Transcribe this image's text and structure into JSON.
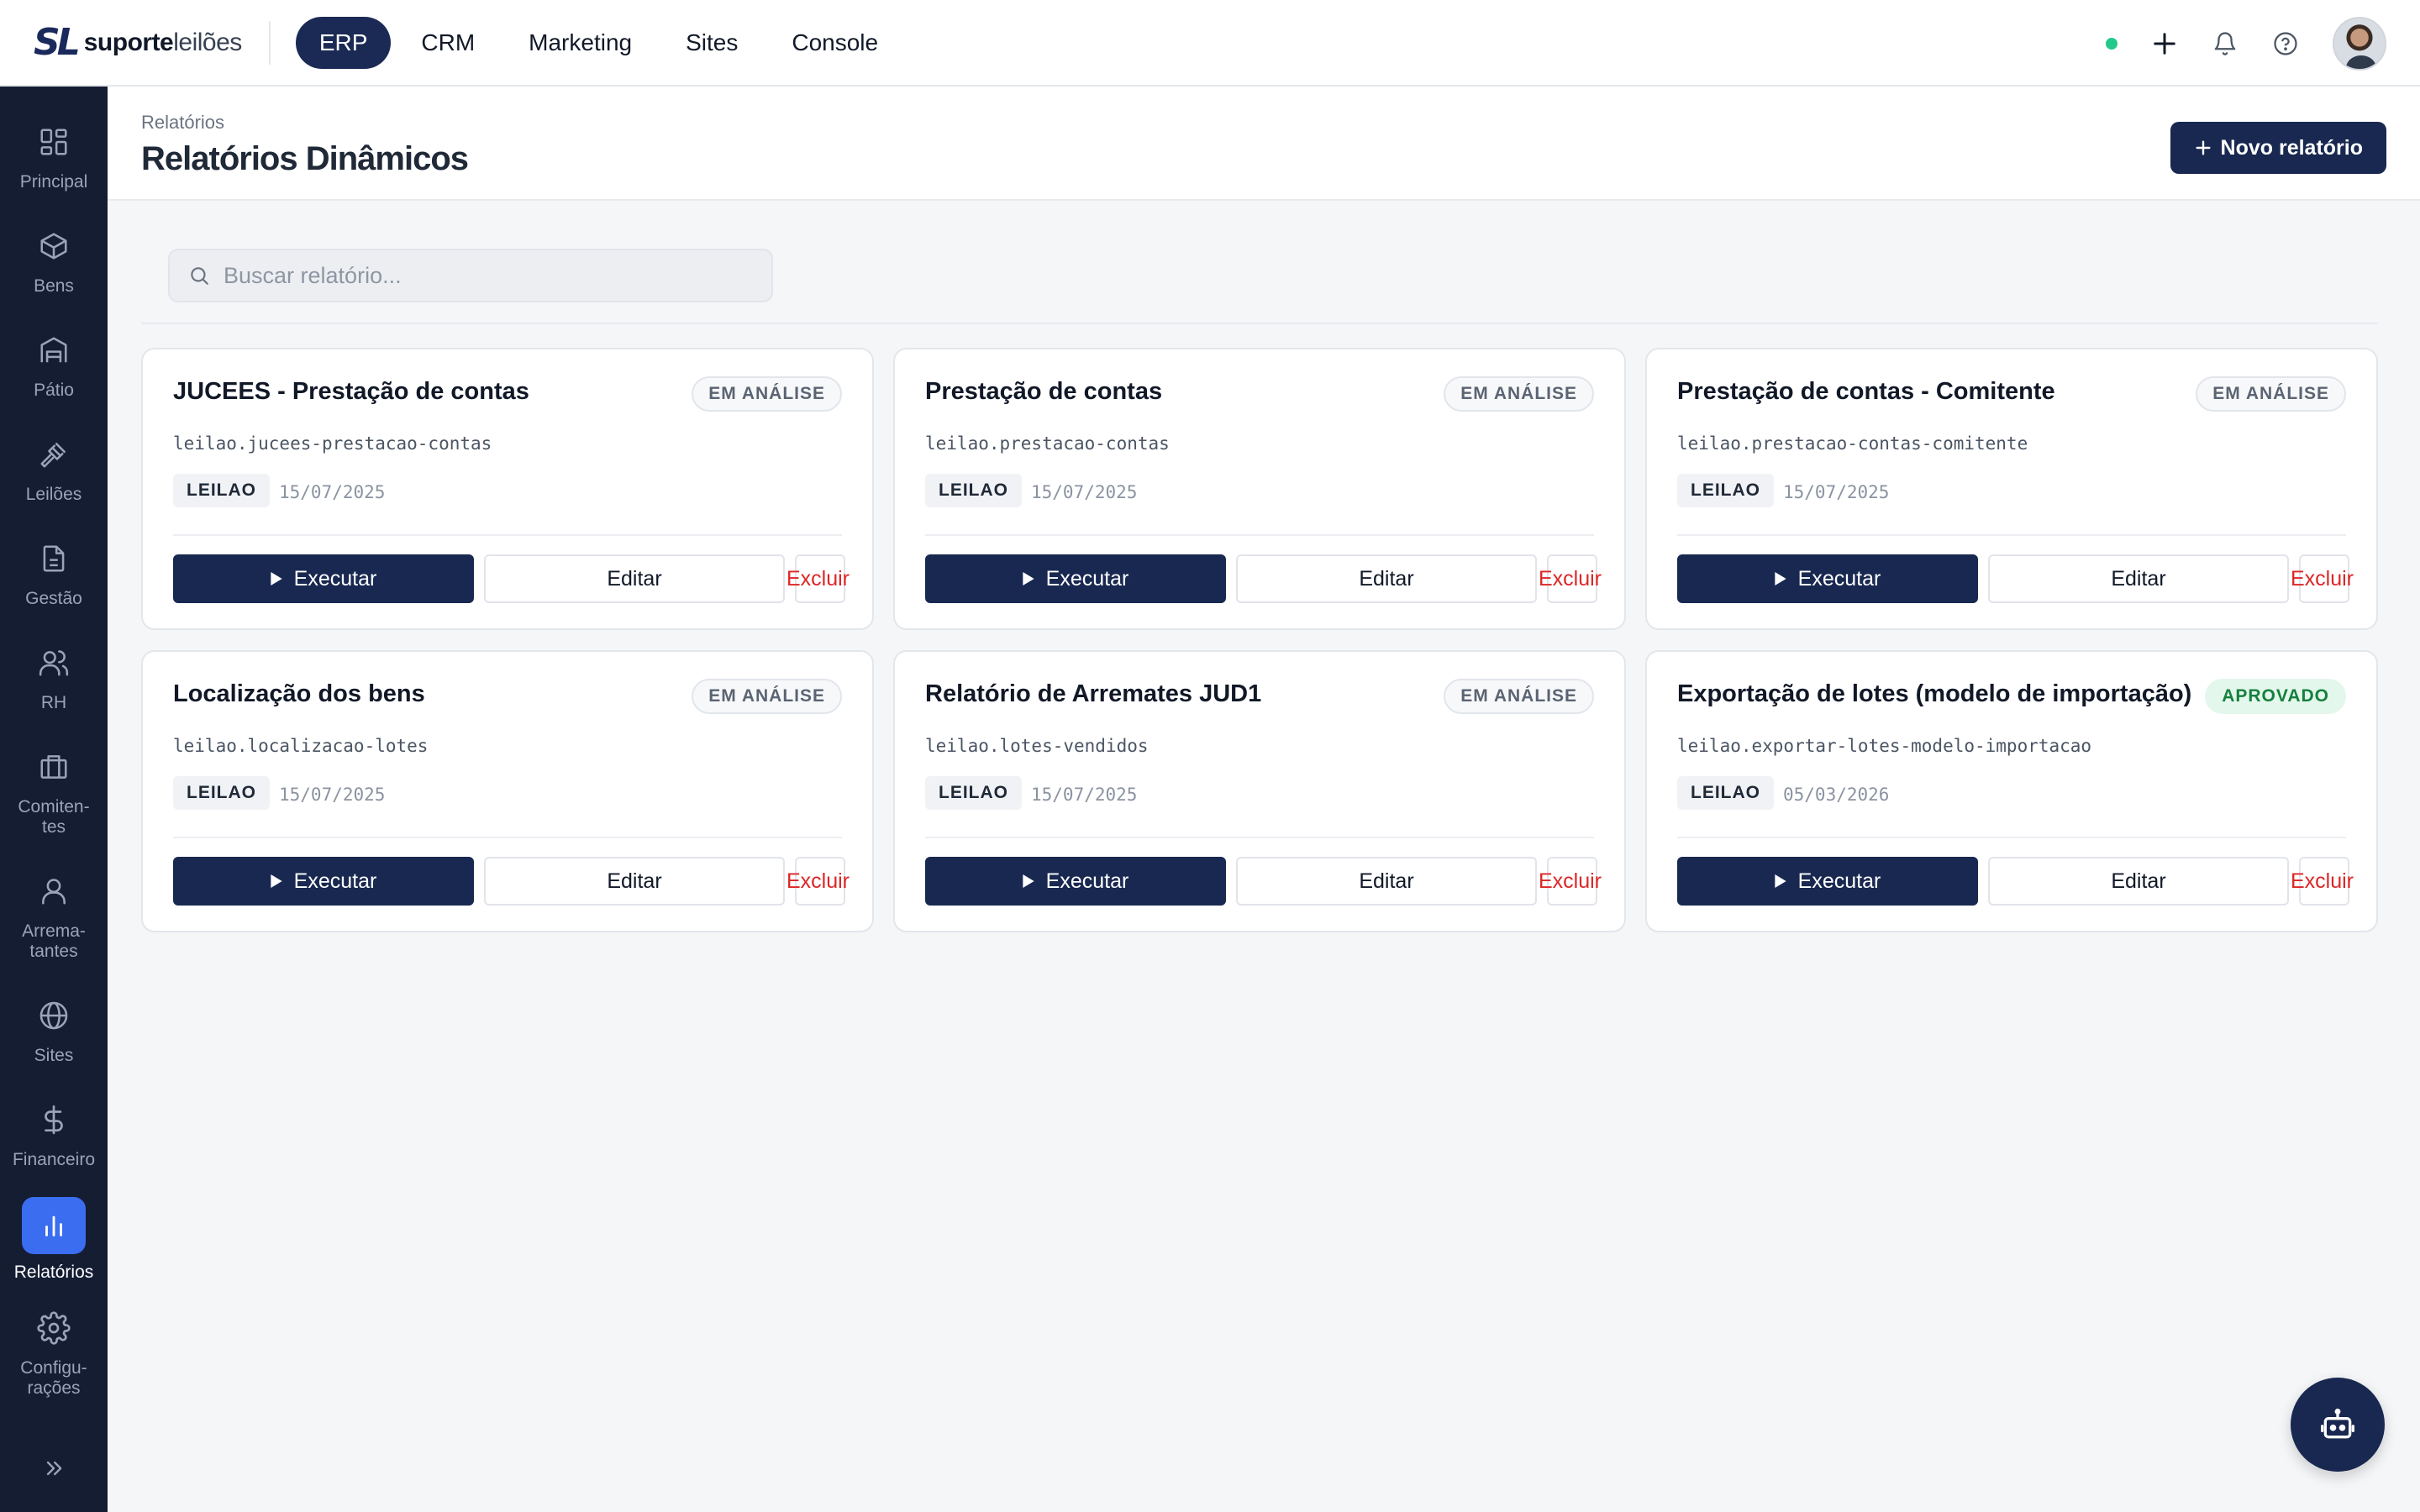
{
  "brand": {
    "mark": "SL",
    "name_bold": "suporte",
    "name_light": "leilões"
  },
  "modules": [
    {
      "label": "ERP",
      "active": true
    },
    {
      "label": "CRM",
      "active": false
    },
    {
      "label": "Marketing",
      "active": false
    },
    {
      "label": "Sites",
      "active": false
    },
    {
      "label": "Console",
      "active": false
    }
  ],
  "top_icons": [
    "status-online-dot",
    "plus-icon",
    "bell-icon",
    "help-icon",
    "avatar"
  ],
  "sidebar": {
    "items": [
      {
        "label": "Principal",
        "icon": "grid-icon"
      },
      {
        "label": "Bens",
        "icon": "box-icon"
      },
      {
        "label": "Pátio",
        "icon": "warehouse-icon"
      },
      {
        "label": "Leilões",
        "icon": "gavel-icon"
      },
      {
        "label": "Gestão",
        "icon": "document-icon"
      },
      {
        "label": "RH",
        "icon": "users-icon"
      },
      {
        "label": "Comiten-\ntes",
        "icon": "briefcase-icon"
      },
      {
        "label": "Arrema-\ntantes",
        "icon": "user-icon"
      },
      {
        "label": "Sites",
        "icon": "globe-icon"
      },
      {
        "label": "Financeiro",
        "icon": "dollar-icon"
      },
      {
        "label": "Relatórios",
        "icon": "bar-chart-icon",
        "active": true
      },
      {
        "label": "Configu-\nrações",
        "icon": "gear-icon"
      }
    ],
    "collapse_icon": "chevrons-right-icon"
  },
  "page": {
    "breadcrumb": "Relatórios",
    "title": "Relatórios Dinâmicos",
    "new_button": "Novo relatório"
  },
  "search": {
    "placeholder": "Buscar relatório..."
  },
  "actions": {
    "run": "Executar",
    "edit": "Editar",
    "delete": "Excluir"
  },
  "reports": [
    {
      "title": "JUCEES - Prestação de contas",
      "status": "EM ANÁLISE",
      "code": "leilao.jucees-prestacao-contas",
      "tag": "LEILAO",
      "date": "15/07/2025"
    },
    {
      "title": "Prestação de contas",
      "status": "EM ANÁLISE",
      "code": "leilao.prestacao-contas",
      "tag": "LEILAO",
      "date": "15/07/2025"
    },
    {
      "title": "Prestação de contas - Comitente",
      "status": "EM ANÁLISE",
      "code": "leilao.prestacao-contas-comitente",
      "tag": "LEILAO",
      "date": "15/07/2025"
    },
    {
      "title": "Localização dos bens",
      "status": "EM ANÁLISE",
      "code": "leilao.localizacao-lotes",
      "tag": "LEILAO",
      "date": "15/07/2025"
    },
    {
      "title": "Relatório de Arremates JUD1",
      "status": "EM ANÁLISE",
      "code": "leilao.lotes-vendidos",
      "tag": "LEILAO",
      "date": "15/07/2025"
    },
    {
      "title": "Exportação de lotes (modelo de importação)",
      "status": "APROVADO",
      "code": "leilao.exportar-lotes-modelo-importacao",
      "tag": "LEILAO",
      "date": "05/03/2026"
    }
  ],
  "colors": {
    "primary": "#182850",
    "sidebar": "#151d33",
    "active_nav": "#3b6df0",
    "danger": "#dc2626",
    "approved": "#15803d",
    "online": "#22c98a"
  }
}
